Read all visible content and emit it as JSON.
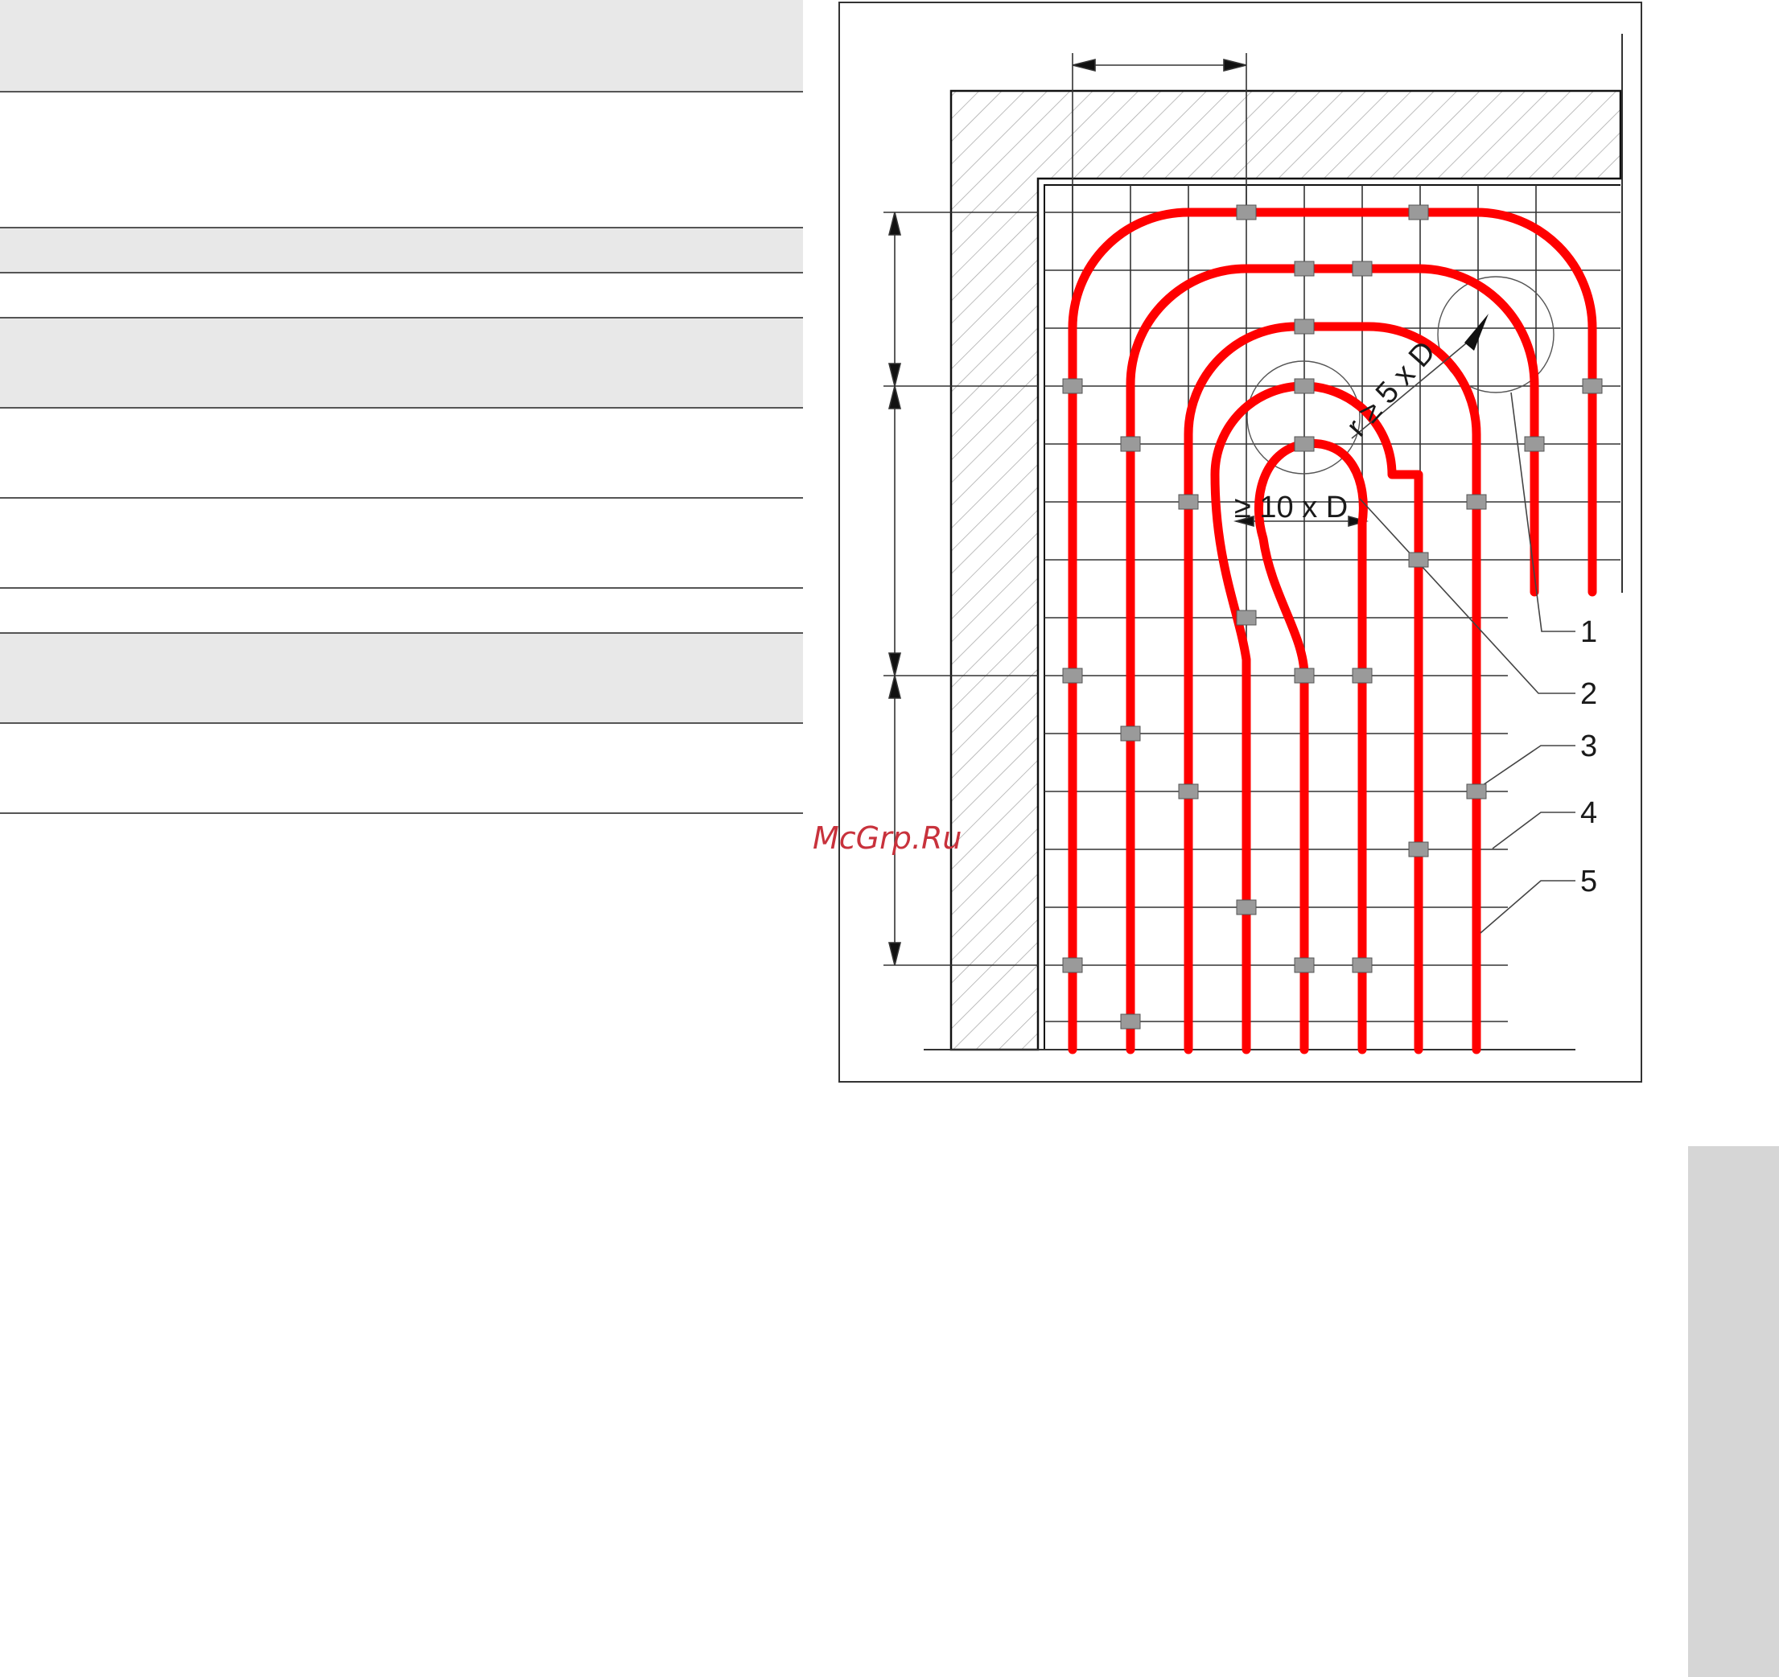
{
  "watermark": {
    "text": "McGrp.Ru"
  },
  "diagram": {
    "callouts": [
      "1",
      "2",
      "3",
      "4",
      "5"
    ],
    "radius_label": "r ≥ 5 x D",
    "spacing_label": "≥ 10 x D",
    "colors": {
      "pipe": "#ff0000",
      "grid": "#333333",
      "wall_hatch": "#999999",
      "clip": "#9a9a9a"
    }
  }
}
